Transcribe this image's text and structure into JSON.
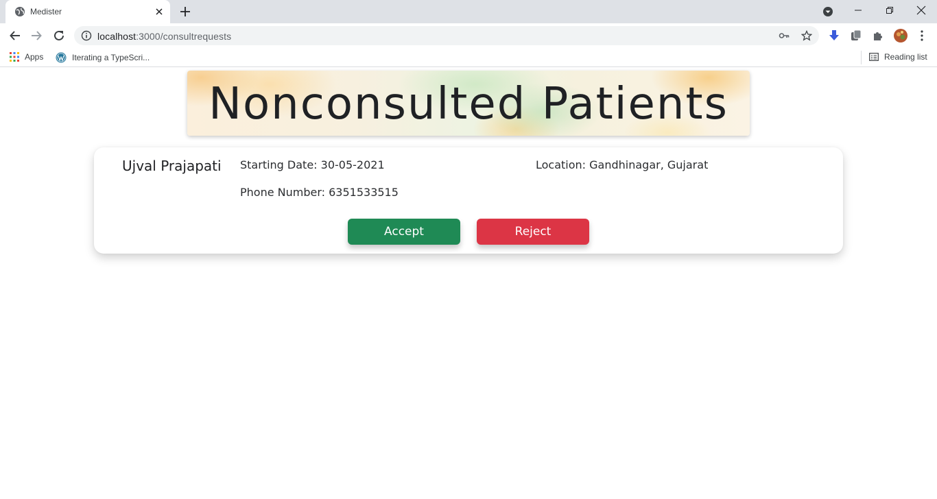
{
  "browser": {
    "tab_title": "Medister",
    "url_host": "localhost",
    "url_path": ":3000/consultrequests",
    "bookmarks": [
      {
        "label": "Apps",
        "icon": "apps-grid-icon"
      },
      {
        "label": "Iterating a TypeScri...",
        "icon": "wordpress-icon"
      }
    ],
    "reading_list_label": "Reading list"
  },
  "page": {
    "banner_title": "Nonconsulted Patients",
    "request": {
      "patient_name": "Ujval Prajapati",
      "starting_date": "Starting Date: 30-05-2021",
      "location": "Location: Gandhinagar, Gujarat",
      "phone": "Phone Number: 6351533515",
      "accept_label": "Accept",
      "reject_label": "Reject"
    }
  },
  "colors": {
    "accept": "#1f8a55",
    "reject": "#dc3545"
  }
}
